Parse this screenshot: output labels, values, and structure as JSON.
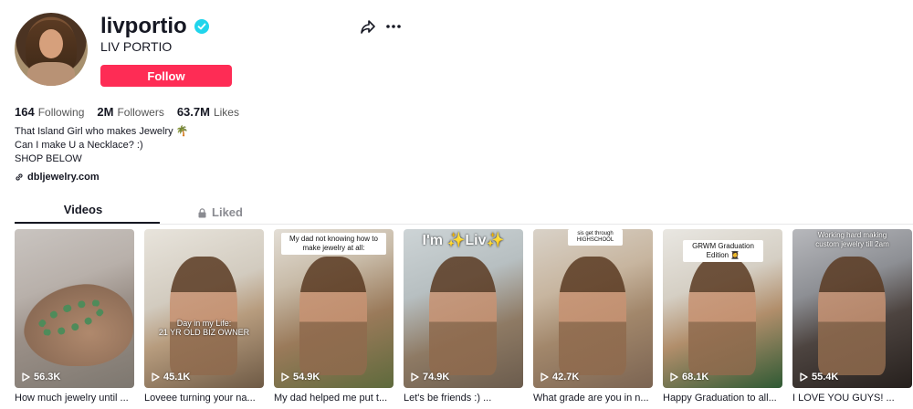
{
  "profile": {
    "username": "livportio",
    "nickname": "LIV PORTIO",
    "verified": true,
    "follow_label": "Follow",
    "accent_color": "#fe2c55",
    "verified_color": "#20d5ec"
  },
  "stats": [
    {
      "value": "164",
      "label": "Following"
    },
    {
      "value": "2M",
      "label": "Followers"
    },
    {
      "value": "63.7M",
      "label": "Likes"
    }
  ],
  "bio": {
    "line1": "That Island Girl who makes Jewelry 🌴",
    "line2": "Can I make U a Necklace? :)",
    "line3": "SHOP BELOW",
    "link": "dbljewelry.com"
  },
  "tabs": {
    "videos": "Videos",
    "liked": "Liked"
  },
  "videos": [
    {
      "views": "56.3K",
      "caption": "How much jewelry until ...",
      "overlay": ""
    },
    {
      "views": "45.1K",
      "caption": "Loveee turning your na...",
      "overlay": "Day in my Life:\n21 YR OLD BIZ OWNER"
    },
    {
      "views": "54.9K",
      "caption": "My dad helped me put t...",
      "overlay": "My dad not knowing how to make jewelry at all:"
    },
    {
      "views": "74.9K",
      "caption": "Let's be friends :) ...",
      "overlay": "I'm ✨Liv✨"
    },
    {
      "views": "42.7K",
      "caption": "What grade are you in n...",
      "overlay": "sis get through HIGHSCHOOL"
    },
    {
      "views": "68.1K",
      "caption": "Happy Graduation to all...",
      "overlay": "GRWM Graduation Edition 👩‍🎓"
    },
    {
      "views": "55.4K",
      "caption": "I LOVE YOU GUYS! ...",
      "overlay": "Working hard making custom jewelry till 2am"
    }
  ]
}
